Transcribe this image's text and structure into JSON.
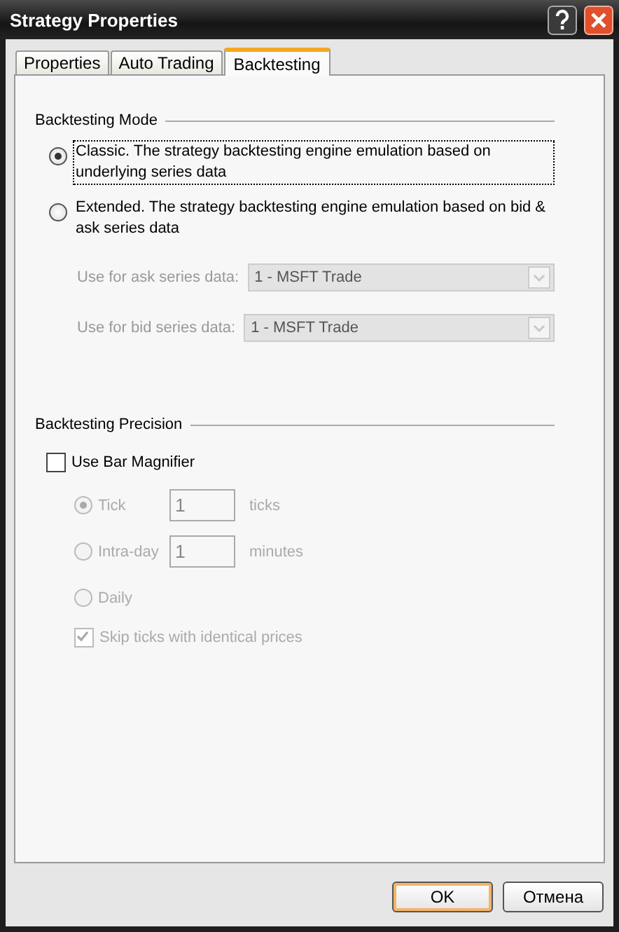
{
  "window": {
    "title": "Strategy Properties"
  },
  "tabs": [
    {
      "label": "Properties",
      "selected": false
    },
    {
      "label": "Auto Trading",
      "selected": false
    },
    {
      "label": "Backtesting",
      "selected": true
    }
  ],
  "backtesting_mode": {
    "title": "Backtesting Mode",
    "options": [
      {
        "label": "Classic. The strategy backtesting engine emulation based on underlying series data",
        "selected": true,
        "focused": true
      },
      {
        "label": "Extended. The strategy backtesting engine emulation based on bid & ask series data",
        "selected": false,
        "focused": false
      }
    ],
    "series_fields": [
      {
        "label": "Use for ask series data:",
        "value": "1 - MSFT Trade",
        "disabled": true
      },
      {
        "label": "Use for bid series data:",
        "value": "1 - MSFT Trade",
        "disabled": true
      }
    ]
  },
  "backtesting_precision": {
    "title": "Backtesting Precision",
    "magnifier": {
      "label": "Use Bar Magnifier",
      "checked": false
    },
    "resolutions": [
      {
        "label": "Tick",
        "selected": true,
        "disabled": true,
        "value": "1",
        "unit": "ticks"
      },
      {
        "label": "Intra-day",
        "selected": false,
        "disabled": true,
        "value": "1",
        "unit": "minutes"
      },
      {
        "label": "Daily",
        "selected": false,
        "disabled": true
      }
    ],
    "skip": {
      "label": "Skip ticks with identical prices",
      "checked": true,
      "disabled": true
    }
  },
  "buttons": [
    {
      "label": "OK",
      "default": true
    },
    {
      "label": "Отмена",
      "default": false
    }
  ]
}
